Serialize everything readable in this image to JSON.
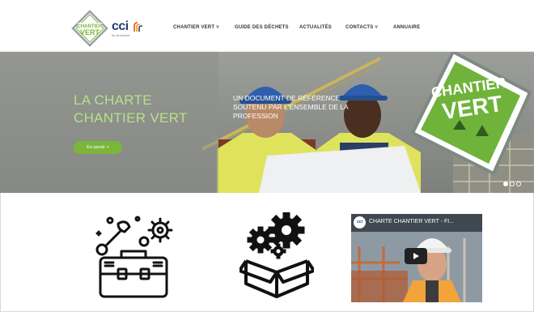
{
  "header": {
    "logo_line1": "CHANTIER",
    "logo_line2": "VERT",
    "cci_label": "cci",
    "cci_sub": "ile-de-france",
    "nav": [
      {
        "label": "CHANTIER VERT",
        "has_dropdown": true
      },
      {
        "label": "GUIDE DES DÉCHETS",
        "has_dropdown": false
      },
      {
        "label": "ACTUALITÉS",
        "has_dropdown": false
      },
      {
        "label": "CONTACTS",
        "has_dropdown": true
      },
      {
        "label": "ANNUAIRE",
        "has_dropdown": false
      }
    ]
  },
  "hero": {
    "title_line1": "LA CHARTE",
    "title_line2": "CHANTIER VERT",
    "subtitle_line1": "UN DOCUMENT DE RÉFÉRENCE",
    "subtitle_line2": "SOUTENU PAR L'ENSEMBLE DE LA",
    "subtitle_line3": "PROFESSION",
    "button_label": "En savoir +",
    "sign_line1": "CHANTIER",
    "sign_line2": "VERT",
    "slides_count": 3,
    "active_slide": 1
  },
  "video": {
    "title": "CHARTE CHANTIER VERT - FI...",
    "channel": "cci"
  },
  "colors": {
    "accent_green": "#7bb63a",
    "title_green": "#b8e08a",
    "brand_navy": "#2b3a6b"
  },
  "icons": [
    "toolbox-gears-icon",
    "gears-box-icon",
    "play-icon"
  ]
}
